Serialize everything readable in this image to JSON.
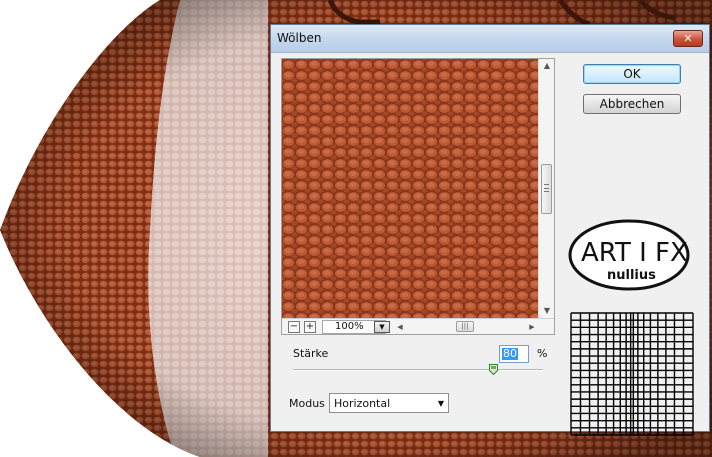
{
  "dialog": {
    "title": "Wölben",
    "close_label": "✕"
  },
  "buttons": {
    "ok_label": "OK",
    "cancel_label": "Abbrechen"
  },
  "preview": {
    "zoom_value": "100%",
    "zoom_out_label": "−",
    "zoom_in_label": "+"
  },
  "controls": {
    "strength_label": "Stärke",
    "strength_value": "80",
    "strength_unit": "%",
    "strength_fraction": 0.8,
    "mode_label": "Modus",
    "mode_value": "Horizontal"
  },
  "logo": {
    "text": "ART I FX",
    "subtext": "nullius"
  },
  "colors": {
    "leather_dark": "#8b3519",
    "leather_mid": "#b4522d",
    "leather_light": "#d27751",
    "dialog_bg": "#f0f0f0",
    "close_red": "#c8543a"
  },
  "icons": {
    "close": "close-icon",
    "zoom_out": "minus-icon",
    "zoom_in": "plus-icon",
    "dropdown": "chevron-down-icon"
  }
}
